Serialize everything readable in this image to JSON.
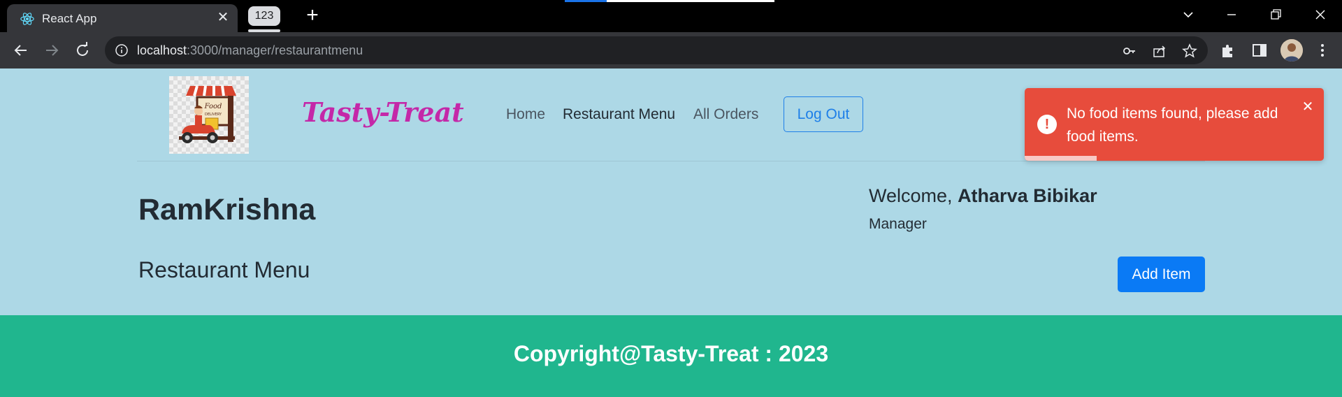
{
  "browser": {
    "tab_title": "React App",
    "tab_group_label": "123",
    "url_host": "localhost",
    "url_rest": ":3000/manager/restaurantmenu"
  },
  "app": {
    "brand": "Tasty-Treat",
    "nav": {
      "home": "Home",
      "restaurant_menu": "Restaurant Menu",
      "all_orders": "All Orders",
      "logout": "Log Out"
    },
    "logo_text": "Food Delivery",
    "restaurant_name": "RamKrishna",
    "welcome_prefix": "Welcome,",
    "user_name": "Atharva Bibikar",
    "user_role": "Manager",
    "section_heading": "Restaurant Menu",
    "add_item_label": "Add Item",
    "footer_text": "Copyright@Tasty-Treat : 2023"
  },
  "toast": {
    "icon": "!",
    "message": "No food items found, please add food items.",
    "progress": 0.24
  },
  "colors": {
    "page_bg": "#add8e6",
    "brand": "#c428a8",
    "primary": "#0a7af5",
    "footer_bg": "#20b68e",
    "toast_bg": "#e74c3c"
  },
  "icons": [
    "react-icon",
    "close-icon",
    "plus-icon",
    "chevron-down-icon",
    "minimize-icon",
    "restore-icon",
    "window-close-icon",
    "back-icon",
    "forward-icon",
    "reload-icon",
    "info-icon",
    "key-icon",
    "share-icon",
    "star-icon",
    "extensions-icon",
    "sidepanel-icon",
    "menu-dots-icon",
    "error-icon"
  ]
}
